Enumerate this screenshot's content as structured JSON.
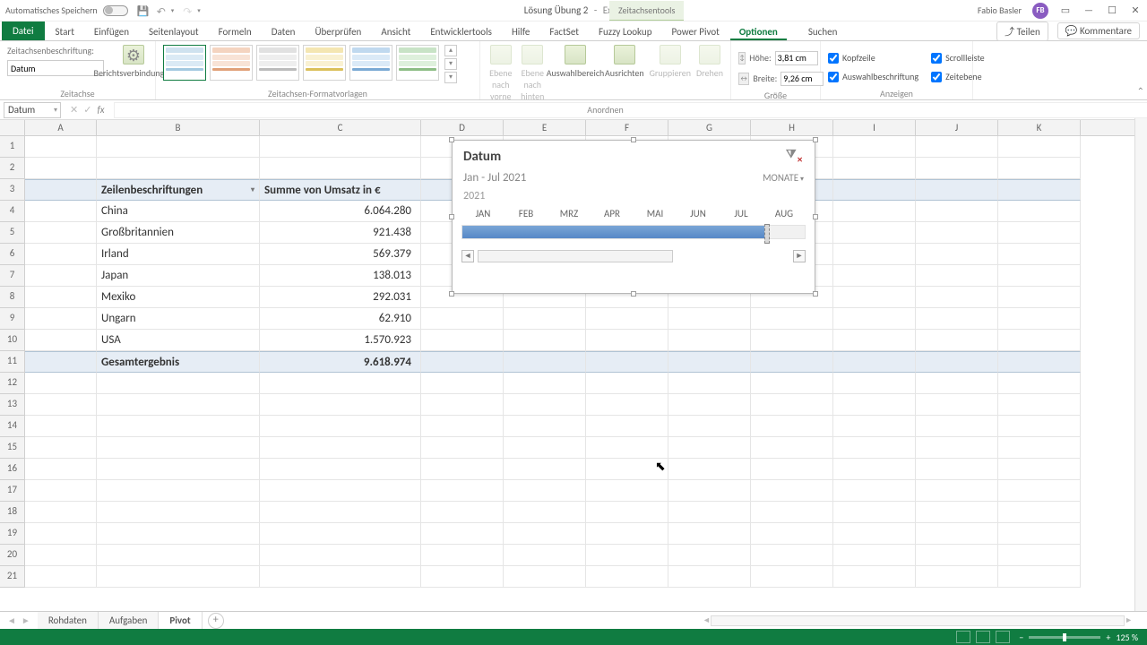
{
  "title": {
    "doc": "Lösung Übung 2",
    "app": "Excel",
    "contextual": "Zeitachsentools"
  },
  "user": {
    "name": "Fabio Basler",
    "initials": "FB"
  },
  "qat": {
    "autosave": "Automatisches Speichern"
  },
  "tabs": {
    "file": "Datei",
    "start": "Start",
    "einf": "Einfügen",
    "layout": "Seitenlayout",
    "formeln": "Formeln",
    "daten": "Daten",
    "ueber": "Überprüfen",
    "ansicht": "Ansicht",
    "dev": "Entwicklertools",
    "hilfe": "Hilfe",
    "factset": "FactSet",
    "fuzzy": "Fuzzy Lookup",
    "pp": "Power Pivot",
    "opt": "Optionen",
    "search": "Suchen",
    "share": "Teilen",
    "comments": "Kommentare"
  },
  "ribbon": {
    "g1_label": "Zeitachse",
    "caption_label": "Zeitachsenbeschriftung:",
    "caption_value": "Datum",
    "conn_btn": "Berichtsverbindungen",
    "g2_label": "Zeitachsen-Formatvorlagen",
    "g3_label": "Anordnen",
    "arr1": "Ebene nach vorne",
    "arr2": "Ebene nach hinten",
    "arr3": "Auswahlbereich",
    "arr4": "Ausrichten",
    "arr5": "Gruppieren",
    "arr6": "Drehen",
    "g4_label": "Größe",
    "hoehe": "Höhe:",
    "breite": "Breite:",
    "h_val": "3,81 cm",
    "b_val": "9,26 cm",
    "g5_label": "Anzeigen",
    "cb1": "Kopfzeile",
    "cb2": "Auswahlbeschriftung",
    "cb3": "Scrollleiste",
    "cb4": "Zeitebene"
  },
  "namebox": "Datum",
  "columns": [
    "A",
    "B",
    "C",
    "D",
    "E",
    "F",
    "G",
    "H",
    "I",
    "J",
    "K"
  ],
  "pivot": {
    "hdr_row": "Zeilenbeschriftungen",
    "hdr_val": "Summe von Umsatz in €",
    "rows": [
      {
        "label": "China",
        "val": "6.064.280"
      },
      {
        "label": "Großbritannien",
        "val": "921.438"
      },
      {
        "label": "Irland",
        "val": "569.379"
      },
      {
        "label": "Japan",
        "val": "138.013"
      },
      {
        "label": "Mexiko",
        "val": "292.031"
      },
      {
        "label": "Ungarn",
        "val": "62.910"
      },
      {
        "label": "USA",
        "val": "1.570.923"
      }
    ],
    "total_label": "Gesamtergebnis",
    "total_val": "9.618.974"
  },
  "slicer": {
    "title": "Datum",
    "range": "Jan - Jul 2021",
    "level": "MONATE",
    "year": "2021",
    "months": [
      "JAN",
      "FEB",
      "MRZ",
      "APR",
      "MAI",
      "JUN",
      "JUL",
      "AUG"
    ]
  },
  "sheets": {
    "s1": "Rohdaten",
    "s2": "Aufgaben",
    "s3": "Pivot"
  },
  "status": {
    "zoom": "125 %"
  }
}
